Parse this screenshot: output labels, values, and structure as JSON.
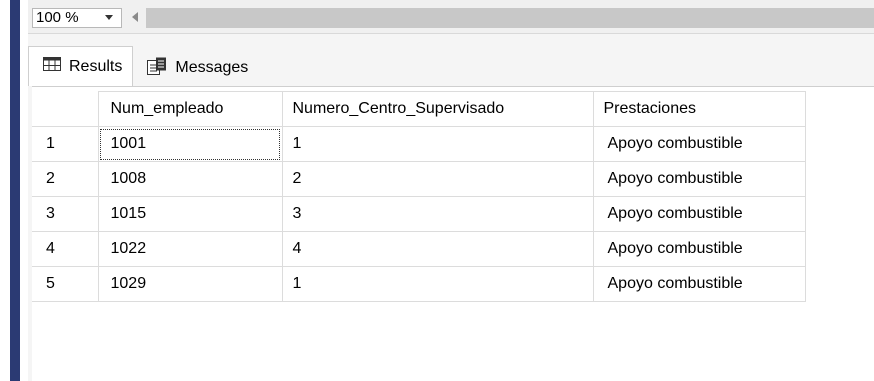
{
  "zoom": {
    "value": "100 %",
    "dropdown_icon": "chevron-down-icon",
    "scroll_left_icon": "arrow-left-icon"
  },
  "tabs": [
    {
      "label": "Results",
      "icon": "grid-icon",
      "active": true
    },
    {
      "label": "Messages",
      "icon": "messages-icon",
      "active": false
    }
  ],
  "grid": {
    "columns": [
      "Num_empleado",
      "Numero_Centro_Supervisado",
      "Prestaciones"
    ],
    "rows": [
      {
        "num": "1",
        "cells": [
          "1001",
          "1",
          "Apoyo combustible"
        ]
      },
      {
        "num": "2",
        "cells": [
          "1008",
          "2",
          "Apoyo combustible"
        ]
      },
      {
        "num": "3",
        "cells": [
          "1015",
          "3",
          "Apoyo combustible"
        ]
      },
      {
        "num": "4",
        "cells": [
          "1022",
          "4",
          "Apoyo combustible"
        ]
      },
      {
        "num": "5",
        "cells": [
          "1029",
          "1",
          "Apoyo combustible"
        ]
      }
    ],
    "selected_cell": {
      "row": 0,
      "col": 0
    }
  },
  "colors": {
    "accent_band": "#2b3a73",
    "grid_line": "#dcdcdc",
    "toolbar_bg": "#f0f0f0"
  }
}
